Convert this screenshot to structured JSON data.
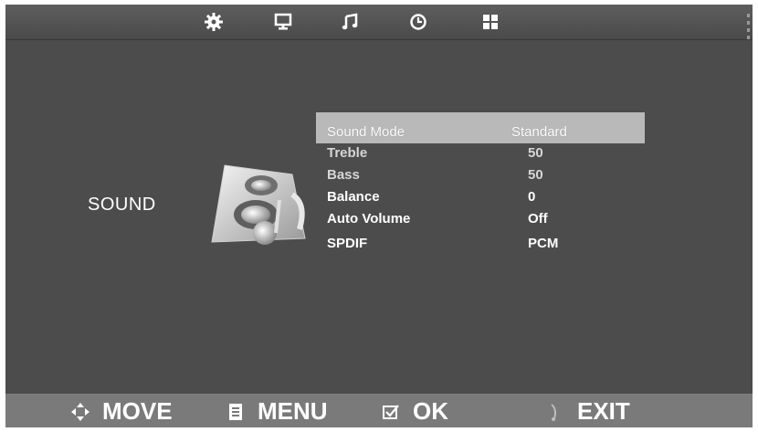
{
  "top_icons": [
    "gear-icon",
    "monitor-icon",
    "music-note-icon",
    "clock-icon",
    "grid-icon"
  ],
  "section": {
    "label": "SOUND"
  },
  "menu": {
    "items": [
      {
        "label": "Sound Mode",
        "value": "Standard"
      },
      {
        "label": "Treble",
        "value": "50"
      },
      {
        "label": "Bass",
        "value": "50"
      },
      {
        "label": "Balance",
        "value": "0"
      },
      {
        "label": "Auto Volume",
        "value": "Off"
      },
      {
        "label": "SPDIF",
        "value": "PCM"
      }
    ]
  },
  "footer": {
    "move_label": "MOVE",
    "menu_label": "MENU",
    "ok_label": "OK",
    "exit_label": "EXIT"
  },
  "colors": {
    "background": "#4c4c4c",
    "highlight": "#b9b9b9",
    "footer": "#7a7a7a",
    "text": "#ffffff"
  }
}
